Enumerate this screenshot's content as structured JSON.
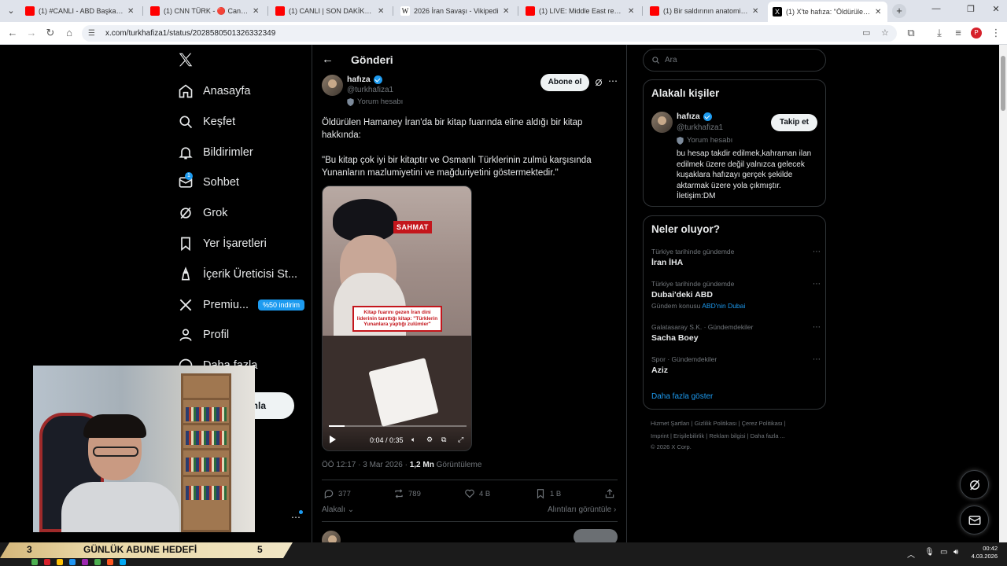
{
  "browser": {
    "tabs": [
      {
        "title": "(1) #CANLI - ABD Başkanı Donald",
        "favicon_color": "#ff0000"
      },
      {
        "title": "(1) CNN TÜRK - 🔴 Canlı Yayın",
        "favicon_color": "#ff0000"
      },
      {
        "title": "(1) CANLI | SON DAKİKA | DUBAİ",
        "favicon_color": "#ff0000"
      },
      {
        "title": "2026 İran Savaşı - Vikipedi",
        "favicon_color": "#ffffff",
        "favicon_letter": "W"
      },
      {
        "title": "(1) LIVE: Middle East real-time",
        "favicon_color": "#ff0000"
      },
      {
        "title": "(1) Bir saldırının anatomisi: Orta",
        "favicon_color": "#ff0000"
      },
      {
        "title": "(1) X'te hafıza: \"Öldürülen Ham",
        "favicon_color": "#000000",
        "favicon_letter": "X"
      }
    ],
    "active_tab_index": 6,
    "url": "x.com/turkhafiza1/status/2028580501326332349"
  },
  "nav": {
    "items": [
      {
        "label": "Anasayfa",
        "icon": "home-icon"
      },
      {
        "label": "Keşfet",
        "icon": "search-icon"
      },
      {
        "label": "Bildirimler",
        "icon": "bell-icon"
      },
      {
        "label": "Sohbet",
        "icon": "mail-icon",
        "badge": "1"
      },
      {
        "label": "Grok",
        "icon": "grok-icon"
      },
      {
        "label": "Yer İşaretleri",
        "icon": "bookmark-icon"
      },
      {
        "label": "İçerik Üreticisi St...",
        "icon": "creator-icon"
      },
      {
        "label": "Premiu...",
        "icon": "x-icon",
        "promo": "%50 indirim"
      },
      {
        "label": "Profil",
        "icon": "profile-icon"
      },
      {
        "label": "Daha fazla",
        "icon": "more-icon"
      }
    ],
    "post_button_partial": "nla"
  },
  "post": {
    "header_title": "Gönderi",
    "author_name": "hafıza",
    "author_handle": "@turkhafiza1",
    "author_label": "Yorum hesabı",
    "subscribe_label": "Abone ol",
    "text_line1": "Öldürülen Hamaney İran'da bir kitap fuarında eline aldığı bir kitap hakkında:",
    "text_line2": "\"Bu kitap çok iyi bir kitaptır ve Osmanlı Türklerinin zulmü karşısında Yunanların mazlumiyetini ve mağduriyetini göstermektedir.\"",
    "video": {
      "logo_text": "SAHMAT",
      "caption": "Kitap fuarını gezen İran dini liderinin tanıttığı kitap: \"Türklerin Yunanlara yaptığı zulümler\"",
      "time": "0:04 / 0:35",
      "progress": 0.114
    },
    "timestamp": "ÖÖ 12:17 · 3 Mar 2026 · ",
    "views_value": "1,2 Mn",
    "views_label": " Görüntüleme",
    "actions": {
      "replies": "377",
      "reposts": "789",
      "likes": "4 B",
      "bookmarks": "1 B"
    },
    "related_label": "Alakalı",
    "quotes_label": "Alıntıları görüntüle"
  },
  "sidebar": {
    "search_placeholder": "Ara",
    "related_title": "Alakalı kişiler",
    "person": {
      "name": "hafıza",
      "handle": "@turkhafiza1",
      "label": "Yorum hesabı",
      "follow_label": "Takip et",
      "bio": "bu hesap takdir edilmek,kahraman ilan edilmek üzere değil yalnızca gelecek kuşaklara hafızayı gerçek şekilde aktarmak üzere yola çıkmıştır. İletişim:DM"
    },
    "trends_title": "Neler oluyor?",
    "trends": [
      {
        "context": "Türkiye tarihinde gündemde",
        "name": "İran İHA",
        "sub_prefix": "",
        "sub_link": ""
      },
      {
        "context": "Türkiye tarihinde gündemde",
        "name": "Dubai'deki ABD",
        "sub_prefix": "Gündem konusu ",
        "sub_link": "ABD'nin Dubai"
      },
      {
        "context": "Galatasaray S.K. · Gündemdekiler",
        "name": "Sacha Boey",
        "sub_prefix": "",
        "sub_link": ""
      },
      {
        "context": "Spor · Gündemdekiler",
        "name": "Aziz",
        "sub_prefix": "",
        "sub_link": ""
      }
    ],
    "show_more": "Daha fazla göster",
    "footer_line1": "Hizmet Şartları  |  Gizlilik Politikası  |  Çerez Politikası  |",
    "footer_line2": "Imprint  |  Erişilebilirlik  |  Reklam bilgisi  |  Daha fazla ...",
    "footer_line3": "© 2026 X Corp."
  },
  "overlay": {
    "goal_left_num": "3",
    "goal_text": "GÜNLÜK ABUNE HEDEFİ",
    "goal_right_num": "5"
  },
  "taskbar": {
    "time": "00:42",
    "date": "4.03.2026"
  },
  "colors": {
    "accent": "#1d9bf0",
    "background": "#000000",
    "border": "#2f3336",
    "muted": "#71767b"
  }
}
